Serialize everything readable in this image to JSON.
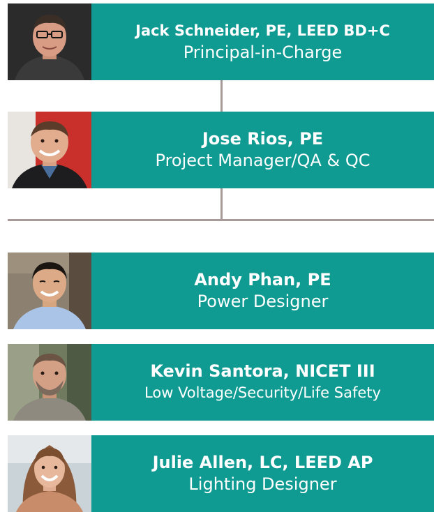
{
  "chart_data": {
    "type": "org-chart",
    "leads": [
      {
        "name": "Jack Schneider, PE, LEED BD+C",
        "role": "Principal-in-Charge"
      },
      {
        "name": "Jose Rios, PE",
        "role": "Project Manager/QA & QC"
      }
    ],
    "team": [
      {
        "name": "Andy Phan, PE",
        "role": "Power Designer"
      },
      {
        "name": "Kevin Santora, NICET III",
        "role": "Low Voltage/Security/Life Safety"
      },
      {
        "name": "Julie Allen, LC, LEED AP",
        "role": "Lighting Designer"
      }
    ]
  },
  "colors": {
    "box": "#0f9a92",
    "text": "#ffffff",
    "connector": "#a99a9a"
  }
}
